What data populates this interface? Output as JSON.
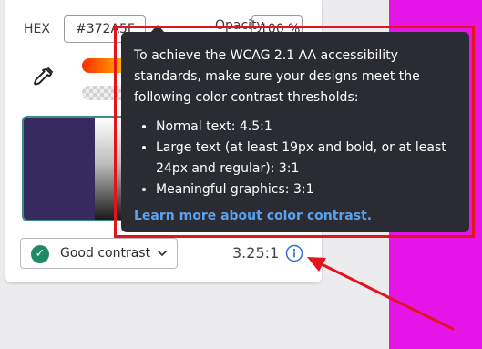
{
  "colors": {
    "swatch": "#372A5F",
    "accent_green": "#1f8a66",
    "tooltip_bg": "#2b2c33",
    "link": "#5aa2ef",
    "annotation_red": "#e3141e",
    "background_magenta": "#e514e7"
  },
  "picker": {
    "hex_label": "HEX",
    "hex_value": "#372A5F",
    "opacity_label": "Opacity",
    "opacity_value": "100 %",
    "eyedropper_icon": "eyedropper-icon"
  },
  "contrast": {
    "status_icon": "check-circle-icon",
    "status_label": "Good contrast",
    "dropdown_icon": "chevron-down-icon",
    "ratio": "3.25:1",
    "info_icon": "info-icon"
  },
  "tooltip": {
    "intro": "To achieve the WCAG 2.1 AA accessibility standards, make sure your designs meet the following color contrast thresholds:",
    "items": [
      "Normal text: 4.5:1",
      "Large text (at least 19px and bold, or at least 24px and regular): 3:1",
      "Meaningful graphics: 3:1"
    ],
    "link_text": "Learn more about color contrast."
  }
}
